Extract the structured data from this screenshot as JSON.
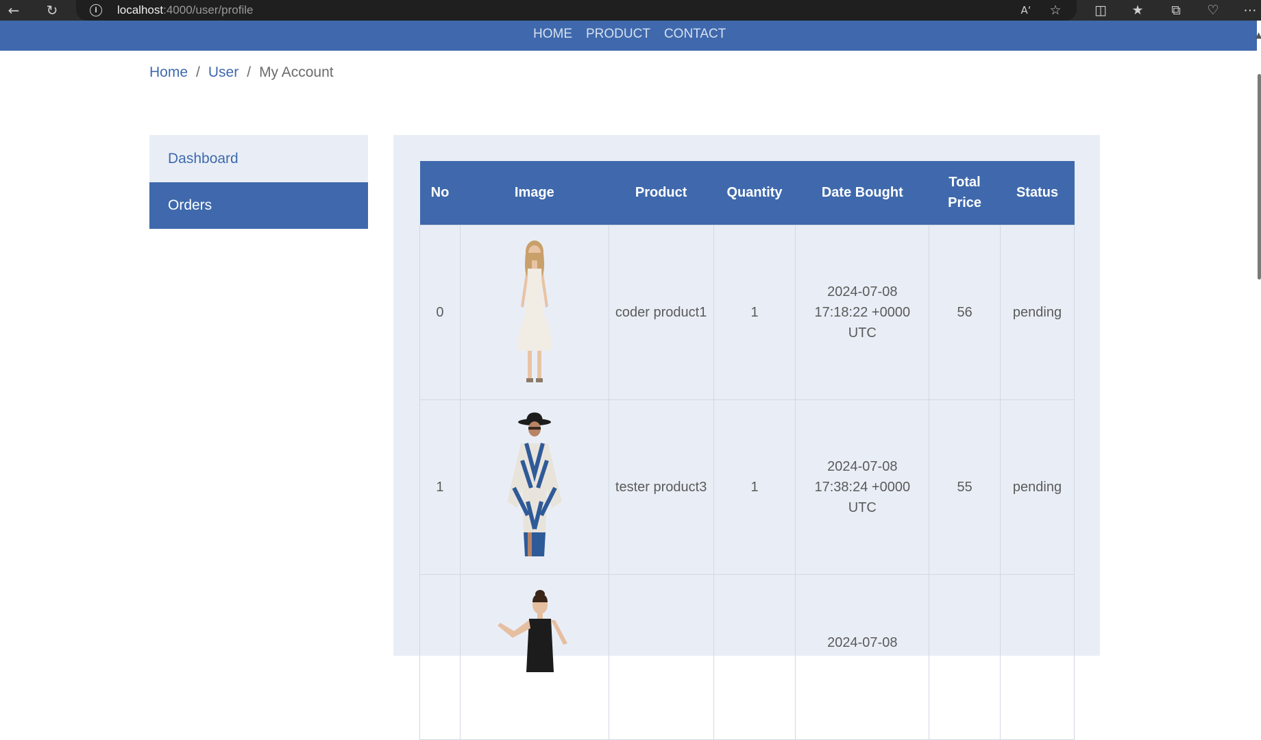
{
  "browser": {
    "url_host": "localhost",
    "url_rest": ":4000/user/profile"
  },
  "nav": {
    "links": [
      "HOME",
      "PRODUCT",
      "CONTACT"
    ]
  },
  "breadcrumb": {
    "home": "Home",
    "user": "User",
    "current": "My Account",
    "separator": "/"
  },
  "sidebar": {
    "items": [
      {
        "label": "Dashboard"
      },
      {
        "label": "Orders"
      }
    ]
  },
  "orders": {
    "headers": [
      "No",
      "Image",
      "Product",
      "Quantity",
      "Date Bought",
      "Total\nPrice",
      "Status"
    ],
    "rows": [
      {
        "no": "0",
        "product": "coder product1",
        "quantity": "1",
        "date": "2024-07-08 17:18:22 +0000 UTC",
        "price": "56",
        "status": "pending"
      },
      {
        "no": "1",
        "product": "tester product3",
        "quantity": "1",
        "date": "2024-07-08 17:38:24 +0000 UTC",
        "price": "55",
        "status": "pending"
      },
      {
        "no": "",
        "product": "",
        "quantity": "",
        "date": "2024-07-08",
        "price": "",
        "status": ""
      }
    ]
  },
  "colors": {
    "brand": "#3f69ac",
    "panel": "#e9eef6"
  }
}
